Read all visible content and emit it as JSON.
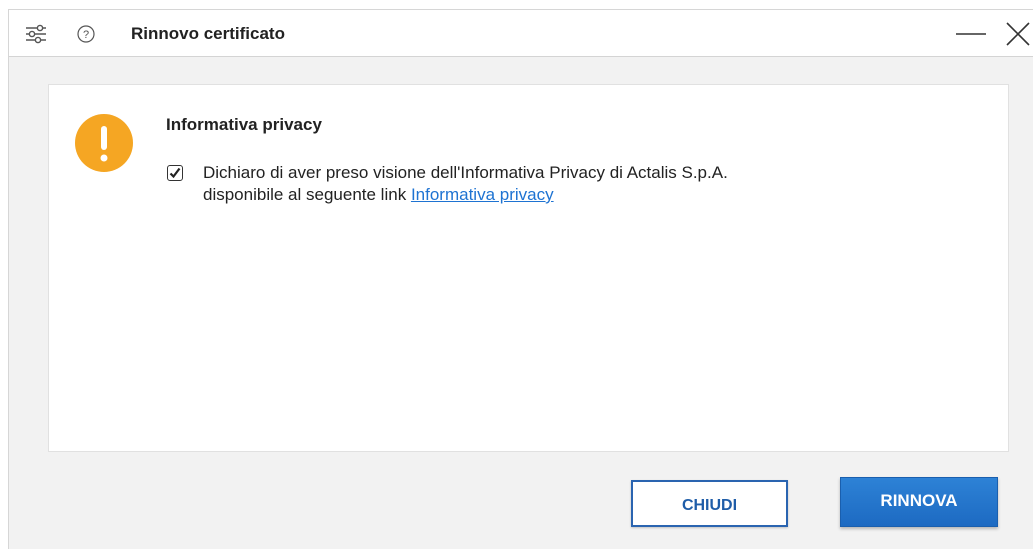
{
  "window": {
    "title": "Rinnovo certificato"
  },
  "titlebar_icons": [
    "settings-sliders-icon",
    "help-icon",
    "minimize-icon",
    "close-icon"
  ],
  "content": {
    "heading": "Informativa privacy",
    "consent_checked": true,
    "consent_text_line1": "Dichiaro di aver preso visione dell'Informativa Privacy di Actalis S.p.A.",
    "consent_text_line2": "disponibile al seguente link",
    "privacy_link": "Informativa privacy"
  },
  "buttons": {
    "close_label": "CHIUDI",
    "renew_label": "RINNOVA"
  },
  "colors": {
    "warning": "#f5a623",
    "primary": "#1f6fc5",
    "link": "#1e73d2"
  }
}
